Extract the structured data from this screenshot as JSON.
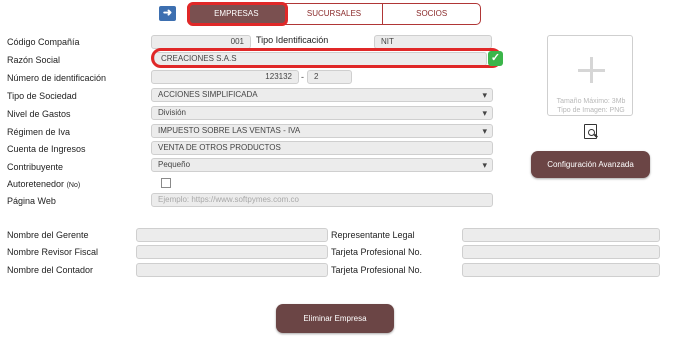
{
  "header": {
    "nav_icon": "arrow-right-icon",
    "tabs": [
      {
        "label": "EMPRESAS",
        "active": true
      },
      {
        "label": "SUCURSALES",
        "active": false
      },
      {
        "label": "SOCIOS",
        "active": false
      }
    ]
  },
  "form": {
    "codigo": {
      "label": "Código Compañía",
      "value": "001"
    },
    "tipo_identificacion": {
      "label": "Tipo Identificación",
      "value": "NIT"
    },
    "razon_social": {
      "label": "Razón Social",
      "value": "CREACIONES S.A.S"
    },
    "numero_identificacion": {
      "label": "Número de identificación",
      "value": "123132",
      "separator": "-",
      "dv": "2"
    },
    "tipo_sociedad": {
      "label": "Tipo de Sociedad",
      "value": "ACCIONES SIMPLIFICADA"
    },
    "nivel_gastos": {
      "label": "Nivel de Gastos",
      "value": "División"
    },
    "regimen_iva": {
      "label": "Régimen de Iva",
      "value": "IMPUESTO SOBRE LAS VENTAS - IVA"
    },
    "cuenta_ingresos": {
      "label": "Cuenta de Ingresos",
      "value": "VENTA DE OTROS PRODUCTOS"
    },
    "contribuyente": {
      "label": "Contribuyente",
      "value": "Pequeño"
    },
    "autoretenedor": {
      "label": "Autoretenedor",
      "label_small": "(No)",
      "checked": false
    },
    "pagina_web": {
      "label": "Página Web",
      "placeholder": "Ejemplo: https://www.softpymes.com.co"
    }
  },
  "people": {
    "gerente": {
      "label": "Nombre del Gerente",
      "value": ""
    },
    "revisor": {
      "label": "Nombre Revisor Fiscal",
      "value": ""
    },
    "contador": {
      "label": "Nombre del Contador",
      "value": ""
    },
    "representante": {
      "label": "Representante Legal",
      "value": ""
    },
    "tarjeta_1": {
      "label": "Tarjeta Profesional No.",
      "value": ""
    },
    "tarjeta_2": {
      "label": "Tarjeta Profesional No.",
      "value": ""
    }
  },
  "image_upload": {
    "max_size": "Tamaño Máximo: 3Mb",
    "image_type": "Tipo de Imagen: PNG"
  },
  "buttons": {
    "advanced": "Configuración Avanzada",
    "delete": "Eliminar Empresa"
  },
  "colors": {
    "accent": "#7a5050",
    "highlight": "#e02828",
    "ok": "#3bb54a",
    "nav": "#3d6fb0"
  }
}
